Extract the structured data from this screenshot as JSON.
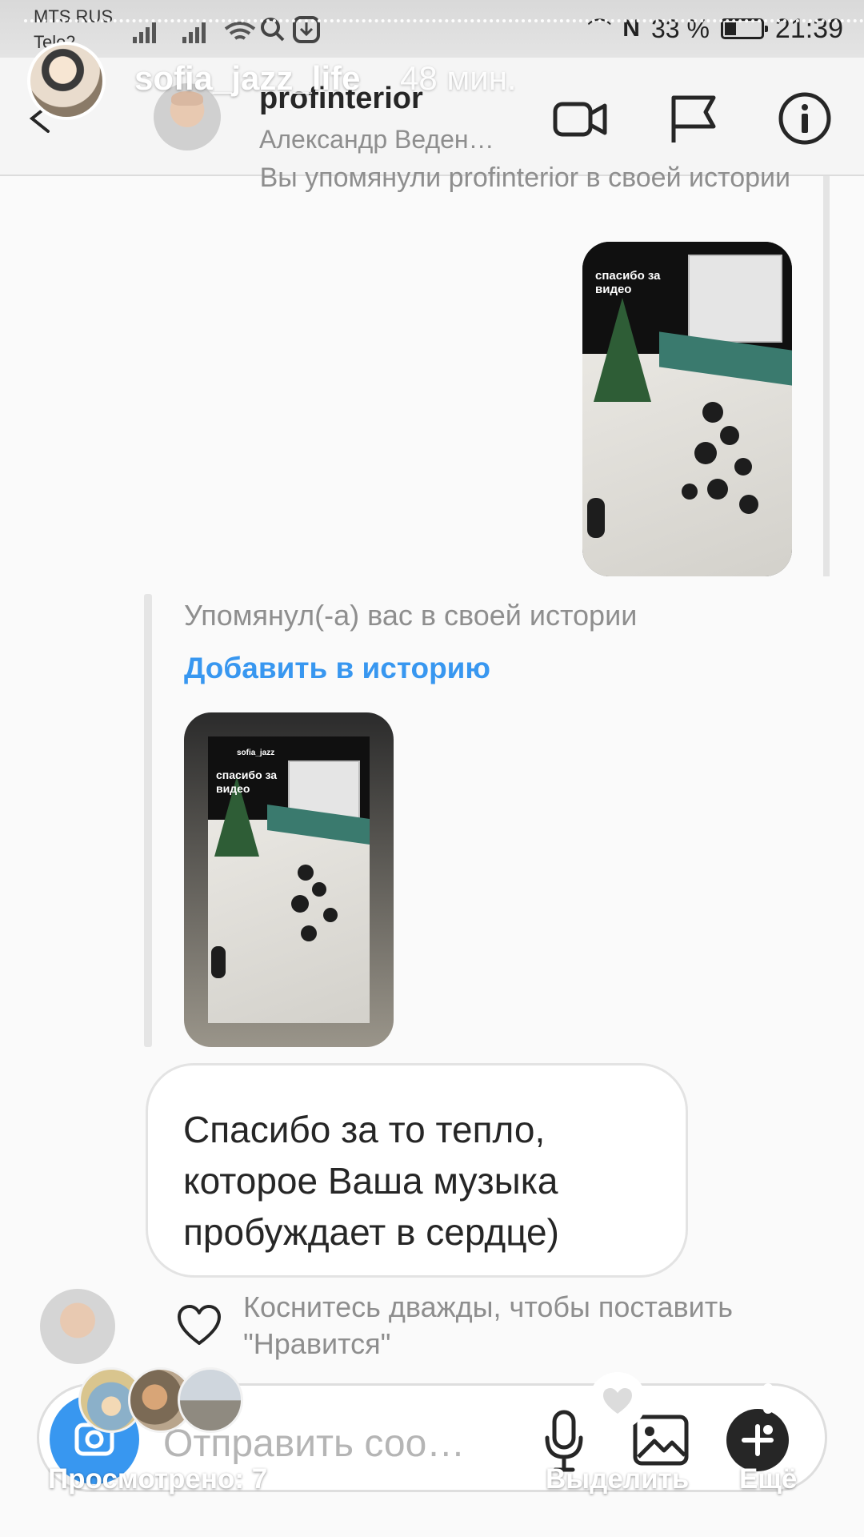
{
  "status_bar": {
    "carrier_1": "MTS RUS",
    "carrier_2": "Tele2",
    "battery": "33 %",
    "time": "21:39"
  },
  "story": {
    "username": "sofia_jazz_life",
    "posted_ago": "48 мин.",
    "viewed_label": "Просмотрено: 7",
    "highlight_label": "Выделить",
    "more_label": "Ещё"
  },
  "dm_header": {
    "username": "profinterior",
    "full_name": "Александр Веден…"
  },
  "thread": {
    "sent_mention": "Вы упомянули profinterior в своей истории",
    "received_mention": "Упомянул(-а) вас в своей истории",
    "add_to_story": "Добавить в историю",
    "thumb_caption_1": "спасибо за видео",
    "thumb_caption_2": "спасибо за видео",
    "thumb_user": "sofia_jazz",
    "message": "Спасибо за то тепло, которое Ваша музыка пробуждает в сердце)",
    "like_hint": "Коснитесь дважды, чтобы поставить \"Нравится\""
  },
  "composer": {
    "placeholder": "Отправить соо…"
  },
  "colors": {
    "accent_blue": "#3897f0",
    "text_primary": "#262626",
    "text_secondary": "#8e8e8e"
  }
}
